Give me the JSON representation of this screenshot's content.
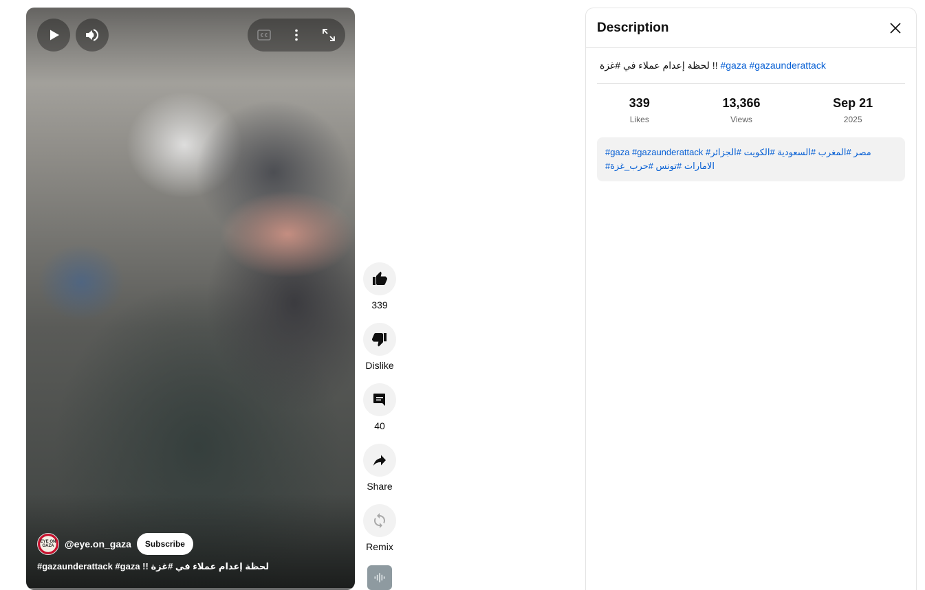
{
  "player": {
    "play_icon": "play-icon",
    "volume_icon": "volume-icon",
    "cc_icon": "closed-captions-icon",
    "more_icon": "more-vert-icon",
    "fullscreen_icon": "fullscreen-icon",
    "channel_handle": "@eye.on_gaza",
    "avatar_text": "EYE ON GAZA",
    "subscribe_label": "Subscribe",
    "title": "#gazaunderattack #gaza !! لحظة إعدام عملاء في #غزة"
  },
  "actions": {
    "like_count": "339",
    "dislike_label": "Dislike",
    "comment_count": "40",
    "share_label": "Share",
    "remix_label": "Remix"
  },
  "description": {
    "header": "Description",
    "title_text": "لحظة إعدام عملاء في #غزة !! ",
    "title_links": "#gaza #gazaunderattack",
    "stats": {
      "likes_value": "339",
      "likes_label": "Likes",
      "views_value": "13,366",
      "views_label": "Views",
      "date_value": "Sep 21",
      "date_label": "2025"
    },
    "tags_line1": "#gaza #gazaunderattack #مصر #المغرب #السعودية #الكويت #الجزائر",
    "tags_line2": "#الامارات #تونس #حرب_غزة"
  },
  "colors": {
    "link": "#065fd4",
    "action_bg": "#f2f2f2"
  }
}
